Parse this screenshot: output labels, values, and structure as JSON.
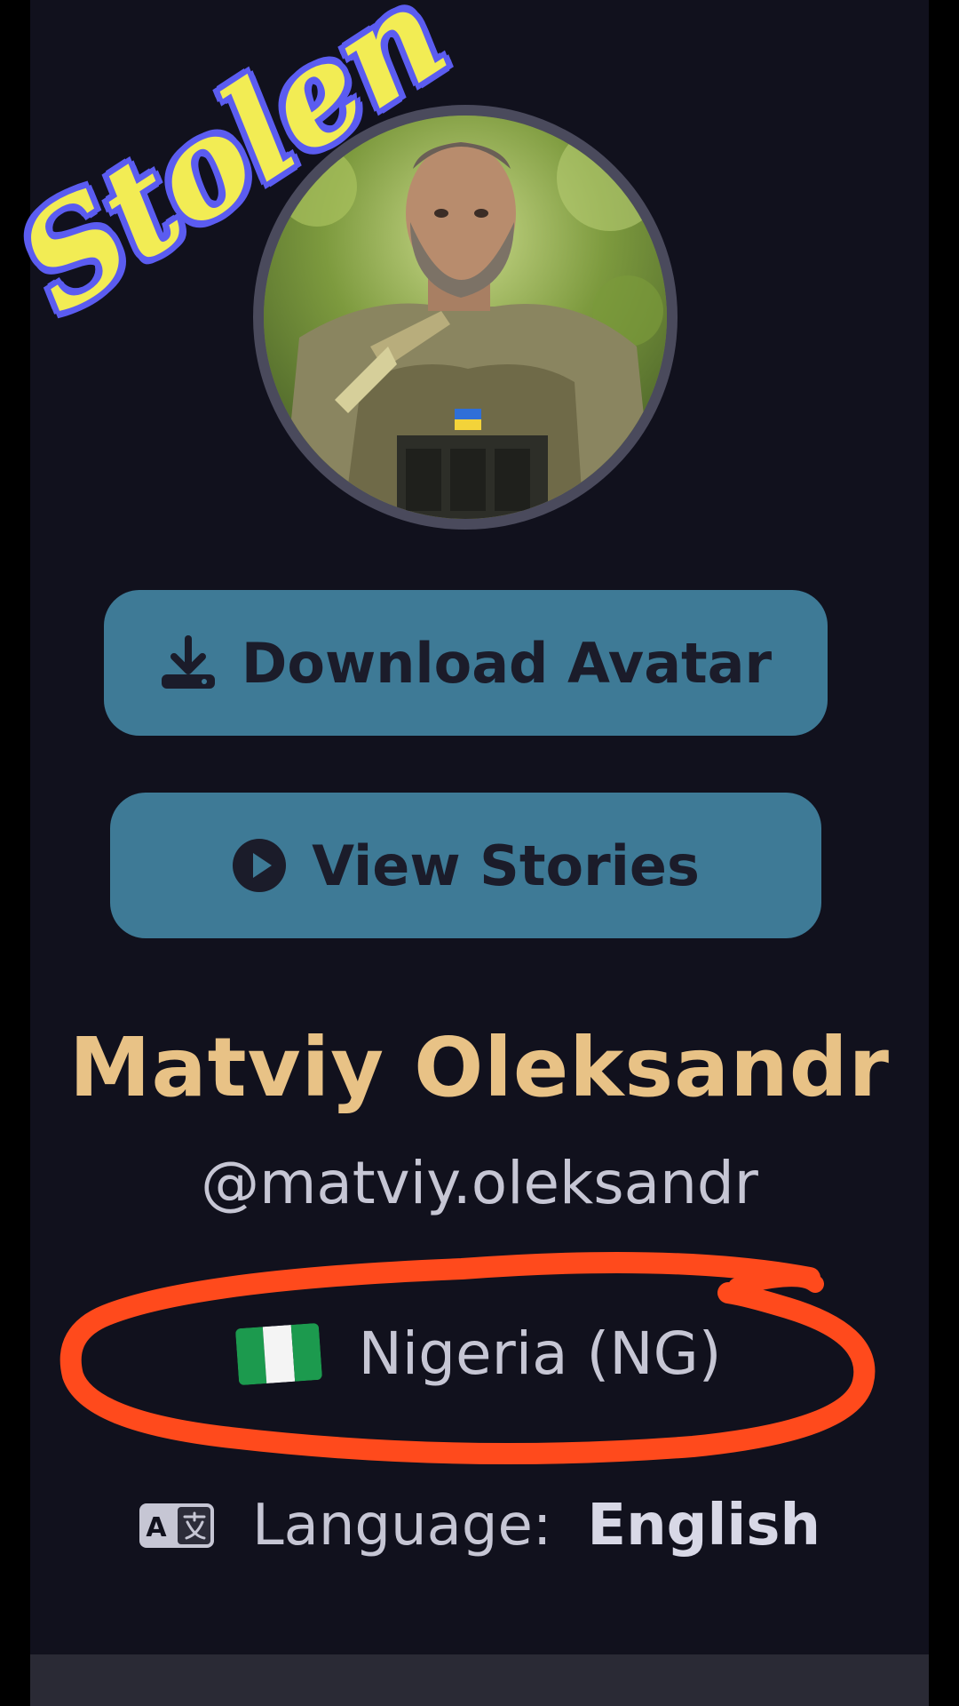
{
  "profile": {
    "display_name": "Matviy Oleksandr",
    "username": "@matviy.oleksandr",
    "country": "Nigeria (NG)",
    "language_label": "Language:",
    "language_value": "English"
  },
  "actions": {
    "download_avatar_label": "Download Avatar",
    "view_stories_label": "View Stories"
  },
  "overlay": {
    "stamp_text": "Stolen",
    "highlight_color": "#ff4a1c"
  },
  "colors": {
    "background": "#11111d",
    "button": "#3e7a96",
    "name": "#e8c286",
    "text": "#c6c6d4"
  },
  "icons": {
    "download": "download-icon",
    "play": "play-icon",
    "flag": "nigeria-flag-icon",
    "translate": "translate-icon"
  }
}
